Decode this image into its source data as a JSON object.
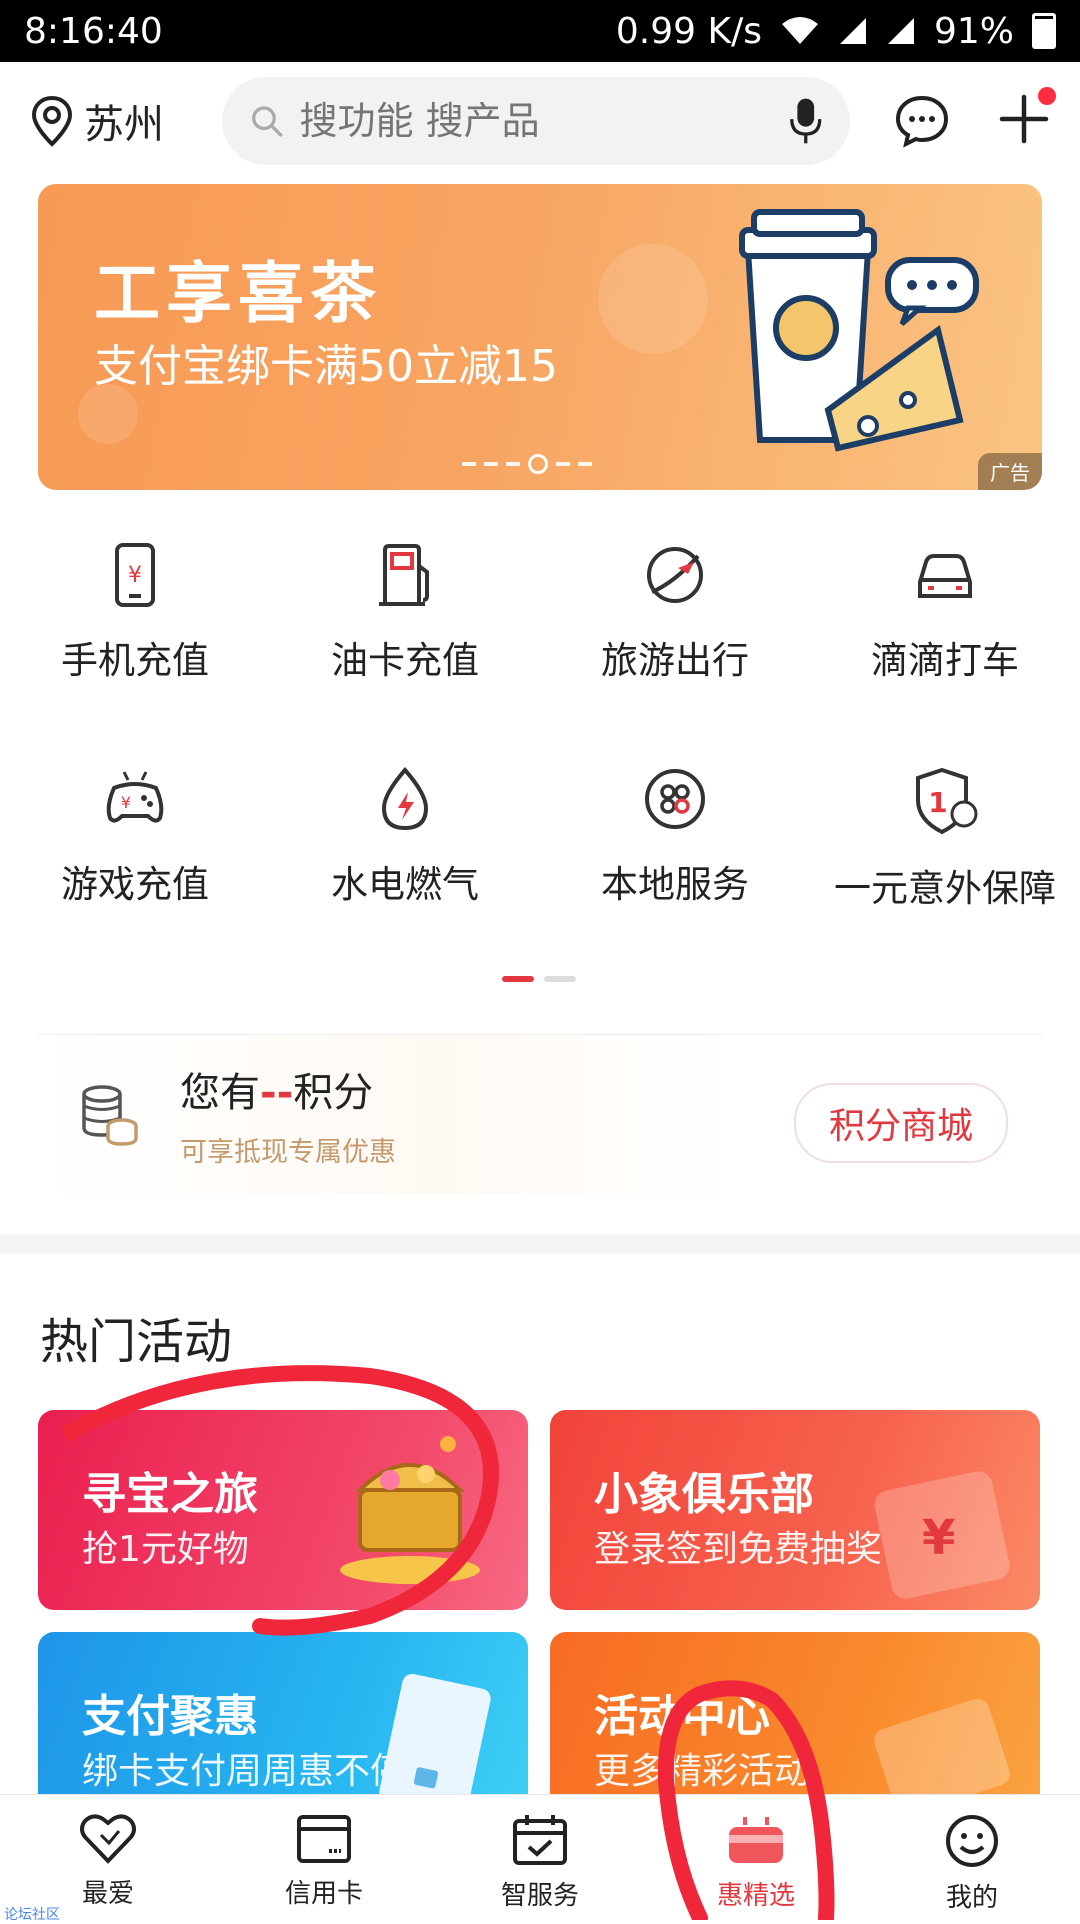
{
  "status_bar": {
    "time": "8:16:40",
    "network_speed": "0.99 K/s",
    "battery": "91%"
  },
  "header": {
    "city": "苏州",
    "search_placeholder": "搜功能 搜产品",
    "icons": [
      "location-icon",
      "search-icon",
      "microphone-icon",
      "message-icon",
      "plus-icon"
    ]
  },
  "banner": {
    "title": "工享喜茶",
    "subtitle": "支付宝绑卡满50立减15",
    "ad_tag": "广告",
    "active_dot": 4,
    "dot_count": 6
  },
  "services": [
    {
      "label": "手机充值",
      "icon": "phone-recharge-icon"
    },
    {
      "label": "油卡充值",
      "icon": "fuel-card-icon"
    },
    {
      "label": "旅游出行",
      "icon": "travel-icon"
    },
    {
      "label": "滴滴打车",
      "icon": "taxi-icon"
    },
    {
      "label": "游戏充值",
      "icon": "game-controller-icon"
    },
    {
      "label": "水电燃气",
      "icon": "utilities-icon"
    },
    {
      "label": "本地服务",
      "icon": "local-services-icon"
    },
    {
      "label": "一元意外保障",
      "icon": "insurance-icon"
    }
  ],
  "points": {
    "prefix": "您有",
    "value": "--",
    "suffix": "积分",
    "subtitle": "可享抵现专属优惠",
    "button": "积分商城"
  },
  "activities": {
    "title": "热门活动",
    "cards": [
      {
        "title": "寻宝之旅",
        "subtitle": "抢1元好物"
      },
      {
        "title": "小象俱乐部",
        "subtitle": "登录签到免费抽奖"
      },
      {
        "title": "支付聚惠",
        "subtitle": "绑卡支付周周惠不停"
      },
      {
        "title": "活动中心",
        "subtitle": "更多精彩活动"
      }
    ]
  },
  "tabbar": {
    "items": [
      {
        "label": "最爱",
        "icon": "heart-icon"
      },
      {
        "label": "信用卡",
        "icon": "credit-card-icon"
      },
      {
        "label": "智服务",
        "icon": "calendar-check-icon"
      },
      {
        "label": "惠精选",
        "icon": "gift-icon"
      },
      {
        "label": "我的",
        "icon": "smiley-icon"
      }
    ],
    "active_index": 3
  },
  "watermark": "论坛社区",
  "colors": {
    "accent": "#e2383f",
    "annotation": "#f0263b"
  }
}
